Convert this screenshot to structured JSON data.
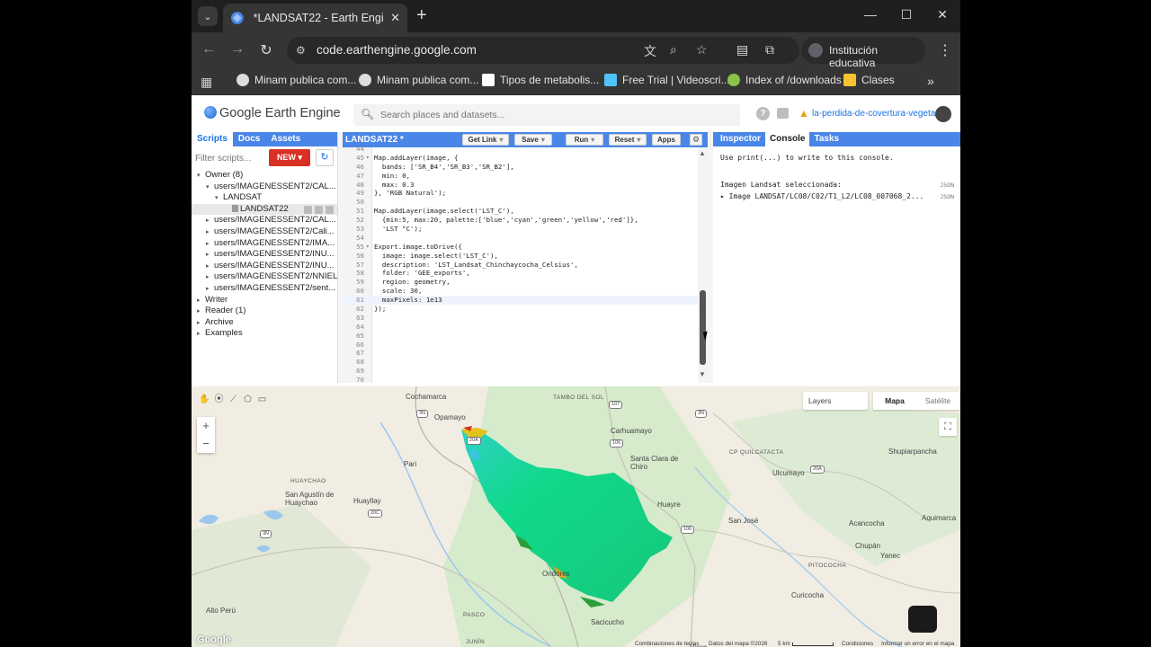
{
  "browser": {
    "tab_title": "*LANDSAT22 - Earth Engine Code Editor",
    "url": "code.earthengine.google.com",
    "profile_label": "Institución educativa",
    "bookmarks": [
      "Minam publica com...",
      "Minam publica com...",
      "Tipos de metabolis...",
      "Free Trial | Videoscri...",
      "Index of /downloads",
      "Clases"
    ]
  },
  "gee": {
    "title": "Google Earth Engine",
    "search_placeholder": "Search places and datasets...",
    "project": "la-perdida-de-covertura-vegeta"
  },
  "left_panel": {
    "tabs": [
      "Scripts",
      "Docs",
      "Assets"
    ],
    "filter_placeholder": "Filter scripts...",
    "new_label": "NEW",
    "tree": [
      {
        "label": "Owner (8)",
        "arrow": "▾",
        "indent": 0
      },
      {
        "label": "users/IMAGENESSENT2/CAL...",
        "arrow": "▾",
        "indent": 1
      },
      {
        "label": "LANDSAT",
        "arrow": "▾",
        "indent": 2
      },
      {
        "label": "LANDSAT22",
        "arrow": "",
        "indent": 3,
        "file": true,
        "selected": true
      },
      {
        "label": "users/IMAGENESSENT2/CAL...",
        "arrow": "▸",
        "indent": 1
      },
      {
        "label": "users/IMAGENESSENT2/Cali...",
        "arrow": "▸",
        "indent": 1
      },
      {
        "label": "users/IMAGENESSENT2/IMA...",
        "arrow": "▸",
        "indent": 1
      },
      {
        "label": "users/IMAGENESSENT2/INU...",
        "arrow": "▸",
        "indent": 1
      },
      {
        "label": "users/IMAGENESSENT2/INU...",
        "arrow": "▸",
        "indent": 1
      },
      {
        "label": "users/IMAGENESSENT2/NNIEL",
        "arrow": "▸",
        "indent": 1
      },
      {
        "label": "users/IMAGENESSENT2/sent...",
        "arrow": "▸",
        "indent": 1
      },
      {
        "label": "Writer",
        "arrow": "▸",
        "indent": 0
      },
      {
        "label": "Reader (1)",
        "arrow": "▸",
        "indent": 0
      },
      {
        "label": "Archive",
        "arrow": "▸",
        "indent": 0
      },
      {
        "label": "Examples",
        "arrow": "▸",
        "indent": 0
      }
    ]
  },
  "editor": {
    "title": "LANDSAT22 *",
    "buttons": [
      "Get Link",
      "Save",
      "Run",
      "Reset",
      "Apps"
    ],
    "lines": [
      {
        "n": "44",
        "t": "",
        "fold": false
      },
      {
        "n": "45",
        "t": "Map.addLayer(image, {",
        "fold": true
      },
      {
        "n": "46",
        "t": "  bands: ['SR_B4','SR_B3','SR_B2'],",
        "fold": false
      },
      {
        "n": "47",
        "t": "  min: 0,",
        "fold": false
      },
      {
        "n": "48",
        "t": "  max: 0.3",
        "fold": false
      },
      {
        "n": "49",
        "t": "}, 'RGB Natural');",
        "fold": false
      },
      {
        "n": "50",
        "t": "",
        "fold": false
      },
      {
        "n": "51",
        "t": "Map.addLayer(image.select('LST_C'),",
        "fold": false
      },
      {
        "n": "52",
        "t": "  {min:5, max:20, palette:['blue','cyan','green','yellow','red']},",
        "fold": false
      },
      {
        "n": "53",
        "t": "  'LST °C');",
        "fold": false
      },
      {
        "n": "54",
        "t": "",
        "fold": false
      },
      {
        "n": "55",
        "t": "Export.image.toDrive({",
        "fold": true
      },
      {
        "n": "56",
        "t": "  image: image.select('LST_C'),",
        "fold": false
      },
      {
        "n": "57",
        "t": "  description: 'LST_Landsat_Chinchaycocha_Celsius',",
        "fold": false
      },
      {
        "n": "58",
        "t": "  folder: 'GEE_exports',",
        "fold": false
      },
      {
        "n": "59",
        "t": "  region: geometry,",
        "fold": false
      },
      {
        "n": "60",
        "t": "  scale: 30,",
        "fold": false
      },
      {
        "n": "61",
        "t": "  maxPixels: 1e13",
        "fold": false,
        "active": true
      },
      {
        "n": "62",
        "t": "});",
        "fold": false
      },
      {
        "n": "63",
        "t": "",
        "fold": false
      },
      {
        "n": "64",
        "t": "",
        "fold": false
      },
      {
        "n": "65",
        "t": "",
        "fold": false
      },
      {
        "n": "66",
        "t": "",
        "fold": false
      },
      {
        "n": "67",
        "t": "",
        "fold": false
      },
      {
        "n": "68",
        "t": "",
        "fold": false
      },
      {
        "n": "69",
        "t": "",
        "fold": false
      },
      {
        "n": "70",
        "t": "",
        "fold": false
      }
    ]
  },
  "right_panel": {
    "tabs": [
      "Inspector",
      "Console",
      "Tasks"
    ],
    "hint": "Use print(...) to write to this console.",
    "logs": [
      {
        "text": "Imagen Landsat seleccionada:",
        "tag": "JSON"
      },
      {
        "text": "▸ Image LANDSAT/LC08/C02/T1_L2/LC08_007068_2...",
        "tag": "JSON"
      }
    ]
  },
  "map": {
    "layers_label": "Layers",
    "map_types": [
      "Mapa",
      "Satélite"
    ],
    "active_map_type": "Mapa",
    "places": [
      {
        "name": "Cochamarca",
        "cls": ""
      },
      {
        "name": "TAMBO DEL SOL",
        "cls": "small"
      },
      {
        "name": "Opamayo",
        "cls": ""
      },
      {
        "name": "Carhuamayo",
        "cls": ""
      },
      {
        "name": "CP QUILCATACTA",
        "cls": "small"
      },
      {
        "name": "Shupiarpancha",
        "cls": ""
      },
      {
        "name": "Santa Clara de Chiro",
        "cls": ""
      },
      {
        "name": "Ulcumayo",
        "cls": ""
      },
      {
        "name": "Pari",
        "cls": ""
      },
      {
        "name": "HUAYCHAO",
        "cls": "small"
      },
      {
        "name": "San Agustín de Huaychao",
        "cls": ""
      },
      {
        "name": "Huayllay",
        "cls": ""
      },
      {
        "name": "Huayre",
        "cls": ""
      },
      {
        "name": "San José",
        "cls": ""
      },
      {
        "name": "Acancocha",
        "cls": ""
      },
      {
        "name": "Aquimarca",
        "cls": ""
      },
      {
        "name": "Chupán",
        "cls": ""
      },
      {
        "name": "Yanec",
        "cls": ""
      },
      {
        "name": "Ondores",
        "cls": ""
      },
      {
        "name": "PITOCOCHA",
        "cls": "small"
      },
      {
        "name": "Curicocha",
        "cls": ""
      },
      {
        "name": "Alto Perú",
        "cls": ""
      },
      {
        "name": "PASCO",
        "cls": "small"
      },
      {
        "name": "Sacicucho",
        "cls": ""
      },
      {
        "name": "Vicco",
        "cls": ""
      },
      {
        "name": "JUNÍN",
        "cls": "small"
      }
    ],
    "shields": [
      "3N",
      "107",
      "3N",
      "106",
      "20A",
      "20A",
      "20C",
      "3N",
      "106"
    ],
    "google": "Google",
    "attribution": [
      "Combinaciones de teclas",
      "Datos del mapa ©2026",
      "5 km",
      "Condiciones",
      "Informar un error en el mapa"
    ]
  }
}
